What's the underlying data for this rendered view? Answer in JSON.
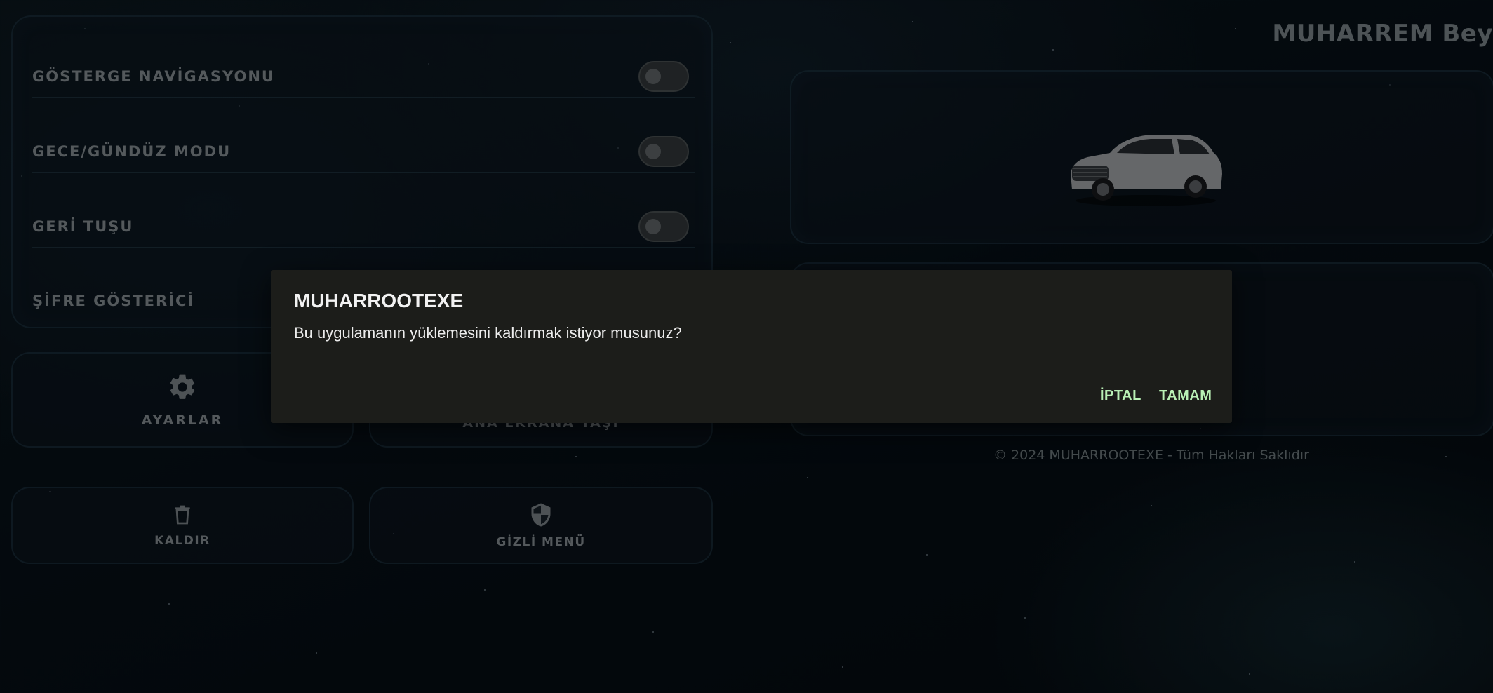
{
  "settings": {
    "rows": [
      {
        "label": "GÖSTERGE NAVİGASYONU",
        "toggle": false
      },
      {
        "label": "GECE/GÜNDÜZ MODU",
        "toggle": false
      },
      {
        "label": "GERİ TUŞU",
        "toggle": false
      },
      {
        "label": "ŞİFRE GÖSTERİCİ"
      }
    ]
  },
  "tiles": {
    "settings": {
      "label": "AYARLAR",
      "icon": "gear-icon"
    },
    "home_screen": {
      "label": "ANA EKRANA TAŞI"
    },
    "uninstall": {
      "label": "KALDIR",
      "icon": "trash-icon"
    },
    "hidden_menu": {
      "label": "GİZLİ MENÜ",
      "icon": "shield-icon"
    }
  },
  "header": {
    "user_name": "MUHARREM Bey"
  },
  "car_card": {
    "image": "car-image"
  },
  "footer": {
    "copyright": "© 2024 MUHARROOTEXE - Tüm Hakları Saklıdır"
  },
  "dialog": {
    "title": "MUHARROOTEXE",
    "message": "Bu uygulamanın yüklemesini kaldırmak istiyor musunuz?",
    "cancel_label": "İPTAL",
    "ok_label": "TAMAM"
  },
  "colors": {
    "accent_button": "#b9f0b5",
    "dialog_bg": "#1c1d1a",
    "label_text": "#9aa3a8"
  }
}
